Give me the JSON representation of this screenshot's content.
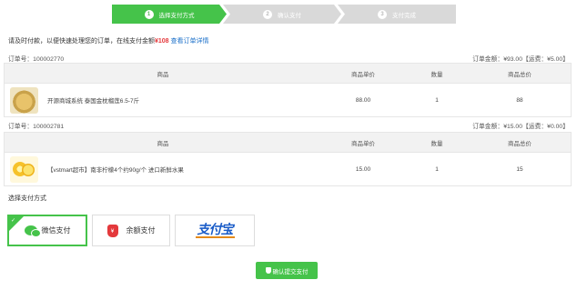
{
  "steps": [
    {
      "num": "1",
      "label": "选择支付方式"
    },
    {
      "num": "2",
      "label": "确认支付"
    },
    {
      "num": "3",
      "label": "支付完成"
    }
  ],
  "notice": {
    "text": "请及时付款，以便快速处理您的订单，在线支付金额",
    "amount": "¥108",
    "link": "查看订单详情"
  },
  "orders": [
    {
      "order_no_label": "订单号：100002770",
      "summary": "订单金额：¥93.00【运费：¥5.00】",
      "headers": [
        "商品",
        "商品单价",
        "数量",
        "商品总价"
      ],
      "item": {
        "image_icon": "durian-image",
        "name": "开源商城系统 泰国金枕榴莲6.5-7斤",
        "price": "88.00",
        "qty": "1",
        "total": "88"
      }
    },
    {
      "order_no_label": "订单号：100002781",
      "summary": "订单金额：¥15.00【运费：¥0.00】",
      "headers": [
        "商品",
        "商品单价",
        "数量",
        "商品总价"
      ],
      "item": {
        "image_icon": "lemon-image",
        "name": "【vstmart超市】南非柠檬4个约90g/个 进口新鲜水果",
        "price": "15.00",
        "qty": "1",
        "total": "15"
      }
    }
  ],
  "payment": {
    "title": "选择支付方式",
    "options": [
      {
        "icon": "wechat-icon",
        "label": "微信支付",
        "selected": true
      },
      {
        "icon": "wallet-icon",
        "label": "余额支付",
        "selected": false
      },
      {
        "icon": "alipay-logo",
        "label": "支付宝",
        "selected": false
      }
    ],
    "submit_label": "确认提交支付"
  },
  "colors": {
    "accent": "#45c34a",
    "price": "#e4393c",
    "link": "#1a6fc9",
    "inactive_step": "#d9d9d9"
  }
}
